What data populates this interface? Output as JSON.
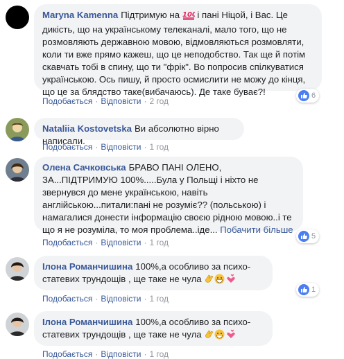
{
  "comments": [
    {
      "author": "Maryna Kamenna",
      "text_before_emoji": "Підтримую на",
      "emoji": "100-emoji",
      "text_after_emoji": "і пані Ніцой, і Вас. Це дикість, що на українському телеканалі, мало того, що не розмовляють державною мовою, відмовляються розмовляти, коли ти вже прямо кажеш, що це неподобство. Так ще й потім скавчать тобі в спину, що ти \"фрік\". Во попросив спілкуватися українською. Ось пишу, й просто осмислити не можу до кінця, що це за блядство таке(вибачаюсь). Де таке буває?!",
      "like": "Подобається",
      "reply": "Відповісти",
      "time": "2 год",
      "reaction_icon": "like-icon",
      "reaction_count": "6"
    },
    {
      "author": "Nataliia Kostovetska",
      "text": "Ви абсолютно вірно написали.",
      "like": "Подобається",
      "reply": "Відповісти",
      "time": "1 год"
    },
    {
      "author": "Олена Сачковська",
      "text": "БРАВО ПАНІ ОЛЕНО, ЗА...ПІДТРИМУЮ 100%.....Була у Польщі і ніхто не звернувся до мене українською, навіть англійською...питали:пані не розуміє?? (польською) і намагалися донести інформацію своєю рідною мовою..і те що я не розуміла, то моя проблема..іде...",
      "see_more": "Побачити більше",
      "like": "Подобається",
      "reply": "Відповісти",
      "time": "1 год",
      "reaction_icon": "like-icon",
      "reaction_count": "5"
    },
    {
      "author": "Ілона Романчишина",
      "text": "100%,а особливо за психо-статевих трундощів , ще таке не чула",
      "emojis": [
        "clap-emoji",
        "grin-emoji",
        "hearts-emoji"
      ],
      "like": "Подобається",
      "reply": "Відповісти",
      "time": "1 год",
      "reaction_icon": "like-icon",
      "reaction_count": "1"
    },
    {
      "author": "Ілона Романчишина",
      "text": "100%,а особливо за психо-статевих трундощів , ще таке не чула",
      "emojis": [
        "clap-emoji",
        "grin-emoji",
        "hearts-emoji"
      ],
      "like": "Подобається",
      "reply": "Відповісти",
      "time": "1 год"
    }
  ],
  "colors": {
    "link": "#385898",
    "bubble": "#f2f3f5",
    "like_blue": "#4c7ef3",
    "meta": "#90949c"
  }
}
